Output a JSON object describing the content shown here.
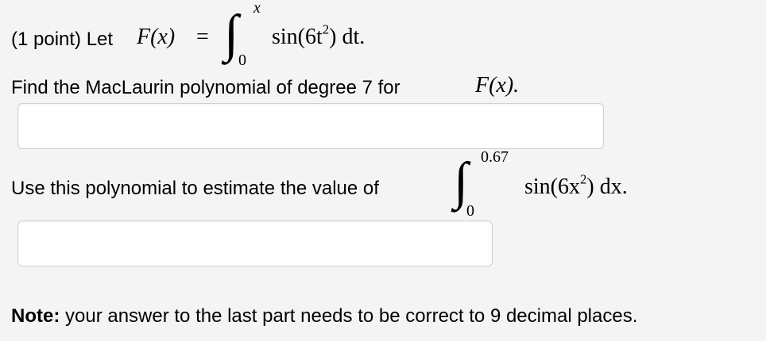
{
  "problem": {
    "points_label": "(1 point) Let",
    "func_lhs": "F(x)",
    "equals": "=",
    "integral1": {
      "upper": "x",
      "lower": "0",
      "integrand_prefix": "sin(6t",
      "integrand_exp": "2",
      "integrand_suffix": ") dt."
    },
    "find_text": "Find the MacLaurin polynomial of degree 7 for",
    "find_func": "F(x).",
    "answer1": {
      "value": "",
      "placeholder": ""
    },
    "estimate_text": "Use this polynomial to estimate the value of",
    "integral2": {
      "upper": "0.67",
      "lower": "0",
      "integrand_prefix": "sin(6x",
      "integrand_exp": "2",
      "integrand_suffix": ") dx."
    },
    "answer2": {
      "value": "",
      "placeholder": ""
    },
    "note_label": "Note:",
    "note_text": " your answer to the last part needs to be correct to 9 decimal places."
  }
}
